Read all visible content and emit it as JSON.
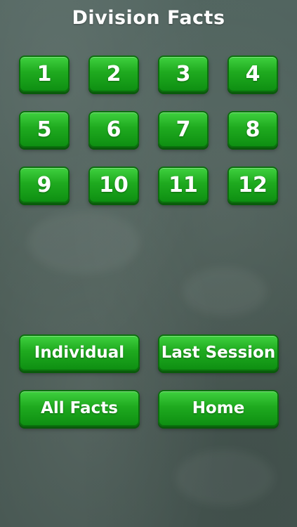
{
  "header": {
    "title": "Division Facts"
  },
  "numbers": [
    "1",
    "2",
    "3",
    "4",
    "5",
    "6",
    "7",
    "8",
    "9",
    "10",
    "11",
    "12"
  ],
  "actions": {
    "individual": "Individual",
    "last_session": "Last Session",
    "all_facts": "All Facts",
    "home": "Home"
  },
  "colors": {
    "background": "#4d5e58",
    "button": "#1faa1f",
    "text": "#ffffff"
  }
}
